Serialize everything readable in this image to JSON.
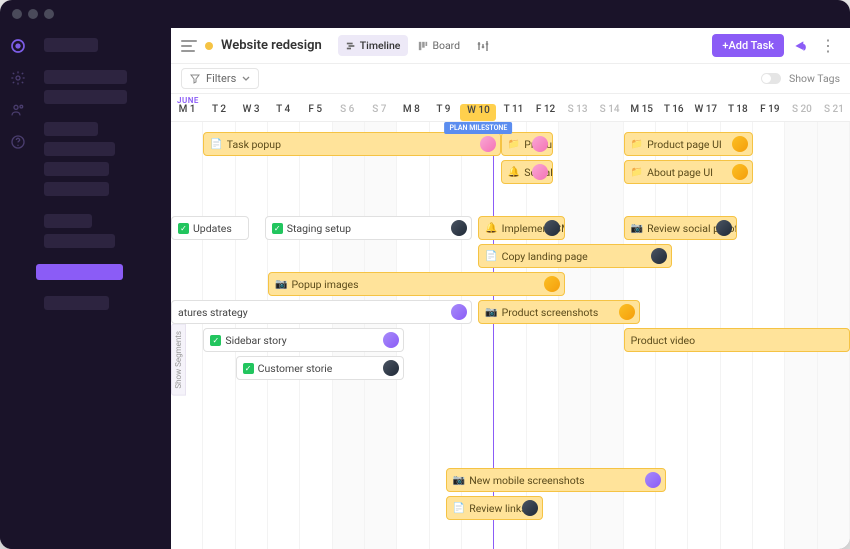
{
  "project": {
    "title": "Website redesign"
  },
  "views": {
    "timeline": "Timeline",
    "board": "Board"
  },
  "toolbar": {
    "filters": "Filters",
    "addTask": "+Add Task",
    "showTags": "Show Tags"
  },
  "timeline": {
    "month": "JUNE",
    "days": [
      {
        "label": "M 1",
        "weekend": false
      },
      {
        "label": "T 2",
        "weekend": false
      },
      {
        "label": "W 3",
        "weekend": false
      },
      {
        "label": "T 4",
        "weekend": false
      },
      {
        "label": "F 5",
        "weekend": false
      },
      {
        "label": "S 6",
        "weekend": true
      },
      {
        "label": "S 7",
        "weekend": true
      },
      {
        "label": "M 8",
        "weekend": false
      },
      {
        "label": "T 9",
        "weekend": false
      },
      {
        "label": "W 10",
        "weekend": false,
        "today": true,
        "milestone": "PLAN MILESTONE"
      },
      {
        "label": "T 11",
        "weekend": false
      },
      {
        "label": "F 12",
        "weekend": false
      },
      {
        "label": "S 13",
        "weekend": true
      },
      {
        "label": "S 14",
        "weekend": true
      },
      {
        "label": "M 15",
        "weekend": false
      },
      {
        "label": "T 16",
        "weekend": false
      },
      {
        "label": "W 17",
        "weekend": false
      },
      {
        "label": "T 18",
        "weekend": false
      },
      {
        "label": "F 19",
        "weekend": false
      },
      {
        "label": "S 20",
        "weekend": true
      },
      {
        "label": "S 21",
        "weekend": true
      }
    ]
  },
  "segments": {
    "label": "Show Segments"
  },
  "tasks": [
    {
      "label": "Task popup",
      "style": "yellow",
      "row": 0,
      "start": 1,
      "span": 9.2,
      "icon": "📄",
      "avatar": "a1"
    },
    {
      "label": "Produc",
      "style": "yellow",
      "row": 0,
      "start": 10.2,
      "span": 1.6,
      "icon": "📁",
      "avatar": "a1"
    },
    {
      "label": "Product page UI",
      "style": "yellow",
      "row": 0,
      "start": 14,
      "span": 4,
      "icon": "📁",
      "avatar": "a2"
    },
    {
      "label": "Social",
      "style": "yellow",
      "row": 1,
      "start": 10.2,
      "span": 1.6,
      "icon": "🔔",
      "avatar": "a1"
    },
    {
      "label": "About page UI",
      "style": "yellow",
      "row": 1,
      "start": 14,
      "span": 4,
      "icon": "📁",
      "avatar": "a2"
    },
    {
      "label": "Updates",
      "style": "white",
      "row": 3,
      "start": 0,
      "span": 2.4,
      "check": true
    },
    {
      "label": "Staging setup",
      "style": "white",
      "row": 3,
      "start": 2.9,
      "span": 6.4,
      "check": true,
      "avatar": "a6"
    },
    {
      "label": "Implement CMS",
      "style": "yellow",
      "row": 3,
      "start": 9.5,
      "span": 2.7,
      "icon": "🔔",
      "avatar": "a6"
    },
    {
      "label": "Review social proof",
      "style": "yellow",
      "row": 3,
      "start": 14,
      "span": 3.5,
      "icon": "📷",
      "avatar": "a6"
    },
    {
      "label": "Copy landing page",
      "style": "yellow",
      "row": 4,
      "start": 9.5,
      "span": 6,
      "icon": "📄",
      "avatar": "a6"
    },
    {
      "label": "Popup images",
      "style": "yellow",
      "row": 5,
      "start": 3,
      "span": 9.2,
      "icon": "📷",
      "avatar": "a2"
    },
    {
      "label": "atures strategy",
      "style": "white",
      "row": 6,
      "start": 0,
      "span": 9.3,
      "avatar": "a3"
    },
    {
      "label": "Product screenshots",
      "style": "yellow",
      "row": 6,
      "start": 9.5,
      "span": 5,
      "icon": "📷",
      "avatar": "a2"
    },
    {
      "label": "Sidebar story",
      "style": "white",
      "row": 7,
      "start": 1,
      "span": 6.2,
      "check": true,
      "avatar": "a3"
    },
    {
      "label": "Product video",
      "style": "yellow",
      "row": 7,
      "start": 14,
      "span": 7,
      "icon": ""
    },
    {
      "label": "Customer storie",
      "style": "white",
      "row": 8,
      "start": 2,
      "span": 5.2,
      "check": true,
      "avatar": "a6"
    },
    {
      "label": "New mobile screenshots",
      "style": "yellow",
      "row": 12,
      "start": 8.5,
      "span": 6.8,
      "icon": "📷",
      "avatar": "a3"
    },
    {
      "label": "Review links",
      "style": "yellow",
      "row": 13,
      "start": 8.5,
      "span": 3,
      "icon": "📄",
      "avatar": "a6"
    }
  ]
}
